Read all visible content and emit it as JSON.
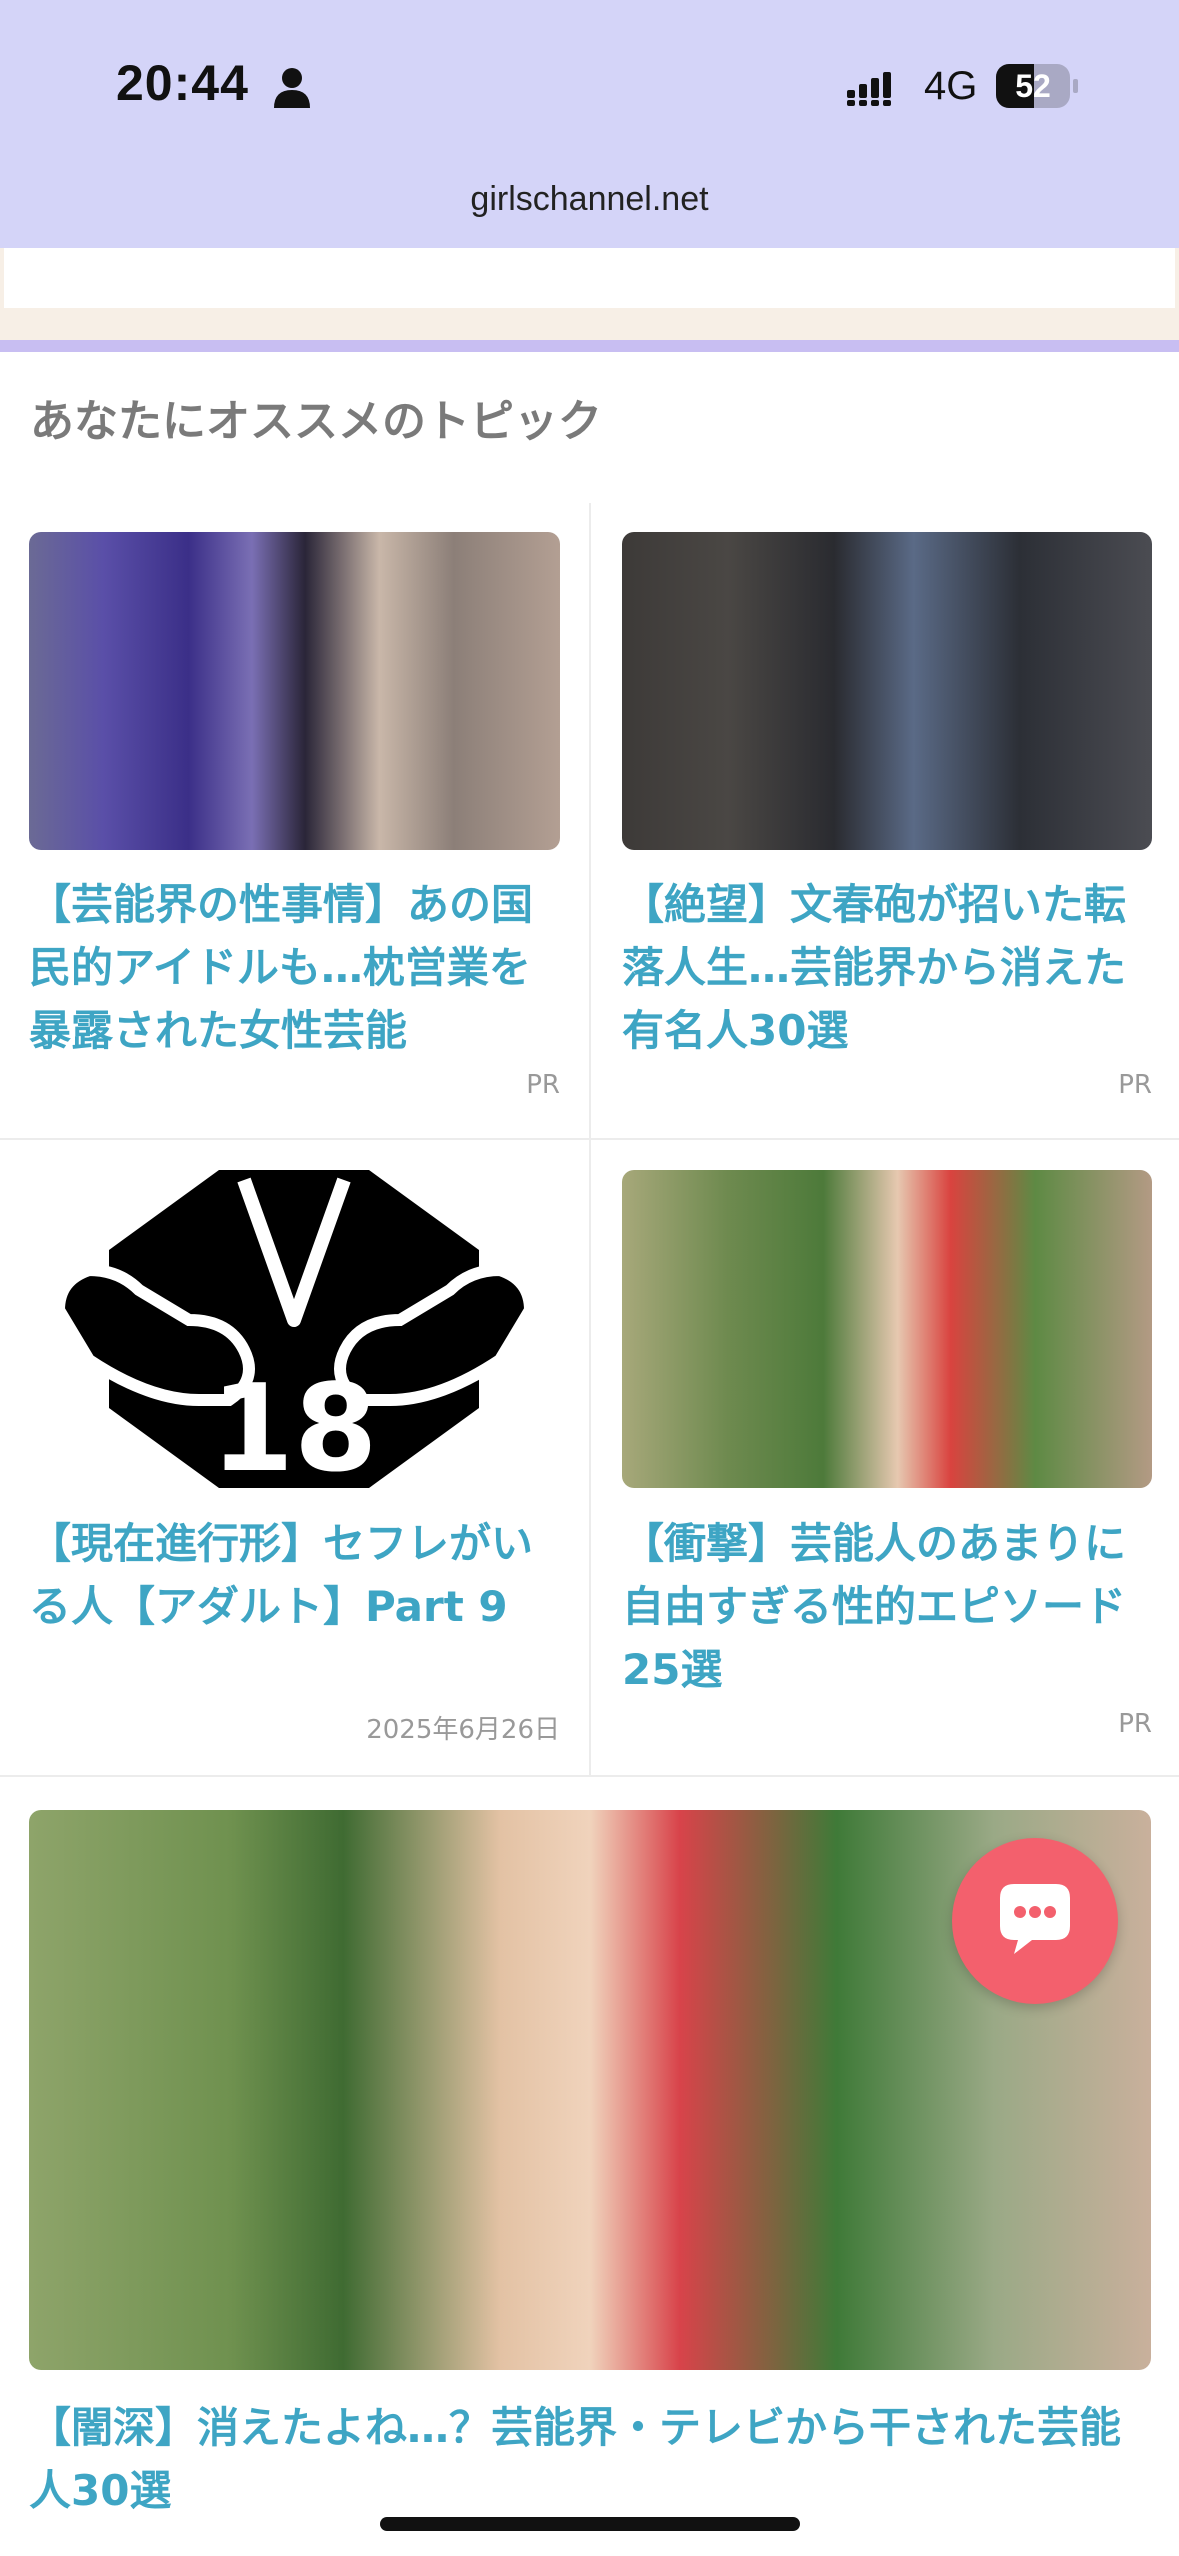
{
  "status_bar": {
    "time": "20:44",
    "network": "4G",
    "battery": "52",
    "battery_level": 0.52
  },
  "browser": {
    "url": "girlschannel.net"
  },
  "section": {
    "title": "あなたにオススメのトピック"
  },
  "cards": [
    {
      "title": "【芸能界の性事情】あの国民的アイドルも…枕営業を暴露された女性芸能",
      "meta": "PR"
    },
    {
      "title": "【絶望】文春砲が招いた転落人生…芸能界から消えた有名人30選",
      "meta": "PR"
    },
    {
      "title": "【現在進行形】セフレがいる人【アダルト】Part 9",
      "meta": "2025年6月26日"
    },
    {
      "title": "【衝撃】芸能人のあまりに自由すぎる性的エピソード25選",
      "meta": "PR"
    },
    {
      "title": "【闇深】消えたよね…？芸能界・テレビから干された芸能人30選"
    }
  ],
  "badge_18": {
    "text": "18"
  },
  "icons": {
    "person": "person-icon",
    "signal": "cellular-signal-icon",
    "battery": "battery-icon",
    "chat": "chat-bubble-icon"
  },
  "colors": {
    "topbar": "#d4d4f8",
    "accent_title": "#3ea5c4",
    "fab": "#f3606d"
  }
}
